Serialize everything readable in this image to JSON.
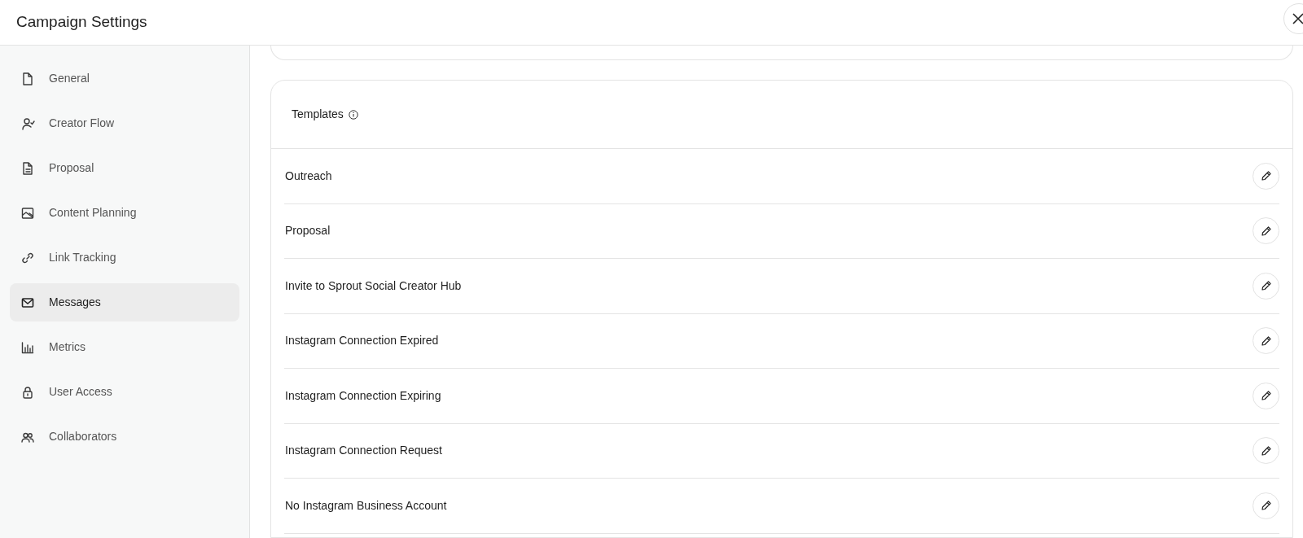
{
  "window": {
    "title": "Campaign Settings"
  },
  "sidebar": {
    "items": [
      {
        "label": "General",
        "kind": "file",
        "selected": false
      },
      {
        "label": "Creator Flow",
        "kind": "person-check",
        "selected": false
      },
      {
        "label": "Proposal",
        "kind": "document",
        "selected": false
      },
      {
        "label": "Content Planning",
        "kind": "image",
        "selected": false
      },
      {
        "label": "Link Tracking",
        "kind": "link",
        "selected": false
      },
      {
        "label": "Messages",
        "kind": "mail",
        "selected": true
      },
      {
        "label": "Metrics",
        "kind": "chart",
        "selected": false
      },
      {
        "label": "User Access",
        "kind": "lock",
        "selected": false
      },
      {
        "label": "Collaborators",
        "kind": "people",
        "selected": false
      }
    ]
  },
  "templates": {
    "title": "Templates",
    "rows": [
      {
        "label": "Outreach"
      },
      {
        "label": "Proposal"
      },
      {
        "label": "Invite to Sprout Social Creator Hub"
      },
      {
        "label": "Instagram Connection Expired"
      },
      {
        "label": "Instagram Connection Expiring"
      },
      {
        "label": "Instagram Connection Request"
      },
      {
        "label": "No Instagram Business Account"
      }
    ]
  }
}
